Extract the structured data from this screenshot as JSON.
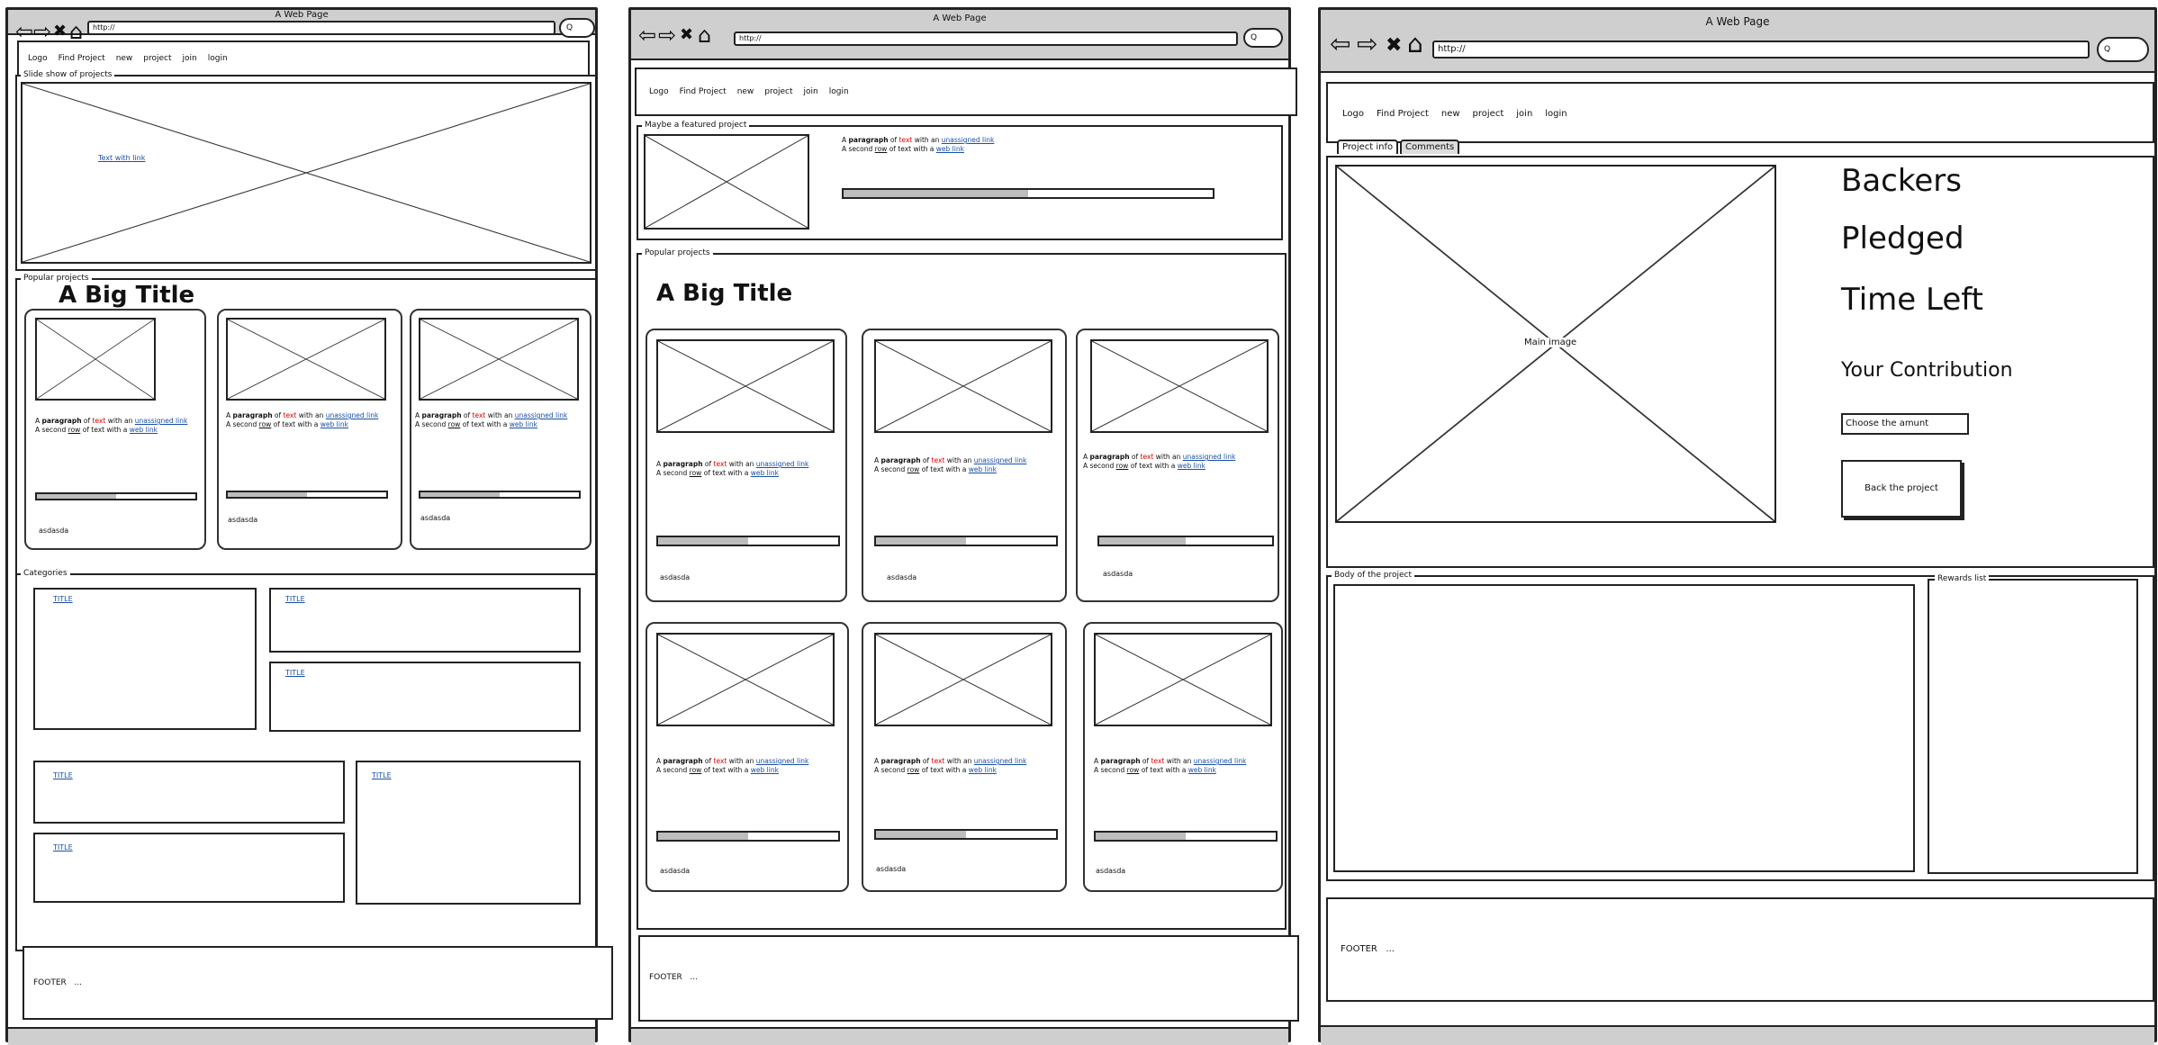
{
  "window_title": "A Web Page",
  "url": "http://",
  "search_glyph": "Q",
  "resize_glyph": "◢",
  "icons": {
    "back": "⇦",
    "forward": "⇨",
    "stop": "✖",
    "home": "⌂"
  },
  "menu": [
    "Logo",
    "Find Project",
    "new",
    "project",
    "join",
    "login"
  ],
  "card": {
    "line1_a": "A ",
    "line1_bold": "paragraph",
    "line1_b": " of ",
    "line1_red": "text",
    "line1_c": " with an ",
    "line1_link": "unassigned link",
    "line2_a": "A second ",
    "line2_u": "row",
    "line2_b": " of text with a ",
    "line2_link": "web link",
    "progress": 0.5,
    "footer_text": "asdasda"
  },
  "big_title": "A Big Title",
  "footer": "FOOTER   ...",
  "page1": {
    "slider_legend": "Slide show of projects",
    "slider_link": "Text with link",
    "popular_legend": "Popular projects",
    "categories_legend": "Categories",
    "category_title": "TITLE"
  },
  "page2": {
    "featured_legend": "Maybe a featured project",
    "popular_legend": "Popular projects"
  },
  "page3": {
    "tabs": [
      "Project info",
      "Comments"
    ],
    "main_image_label": "Main image",
    "stats": [
      "Backers",
      "Pledged",
      "Time Left"
    ],
    "contribution_label": "Your Contribution",
    "amount_placeholder": "Choose the amunt",
    "back_button": "Back the project",
    "body_legend": "Body of the project",
    "rewards_legend": "Rewards list"
  }
}
